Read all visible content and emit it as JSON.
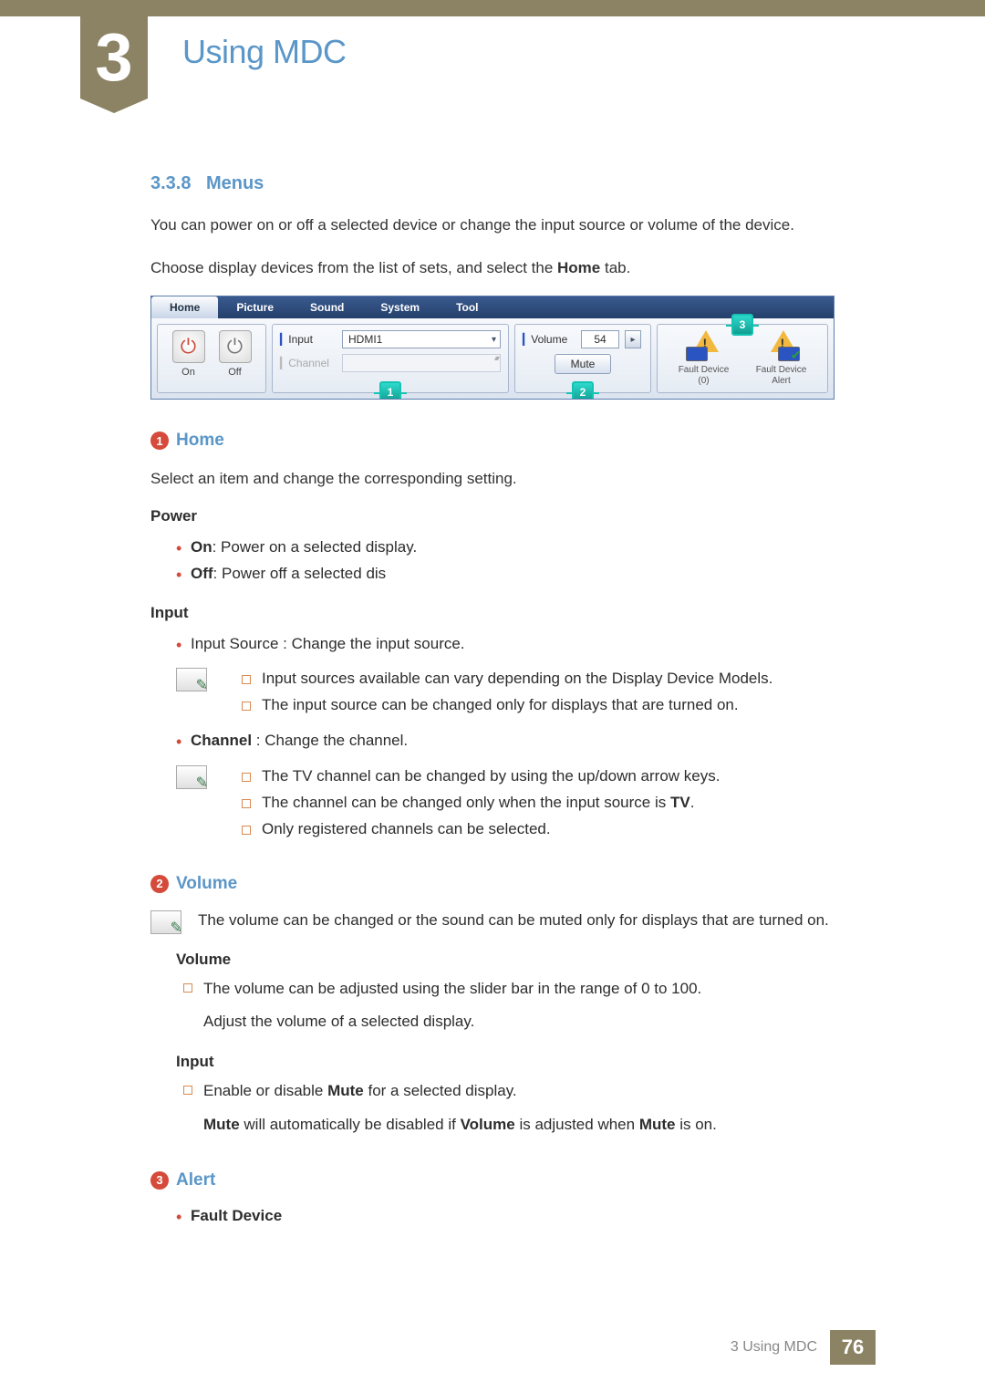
{
  "chapter": {
    "number": "3",
    "title": "Using MDC"
  },
  "section": {
    "number": "3.3.8",
    "title": "Menus"
  },
  "intro1": "You can power on or off a selected device or change the input source or volume of the device.",
  "intro2_a": "Choose display devices from the list of sets, and select the ",
  "intro2_bold": "Home",
  "intro2_b": " tab.",
  "ui": {
    "tabs": [
      "Home",
      "Picture",
      "Sound",
      "System",
      "Tool"
    ],
    "power": {
      "on": "On",
      "off": "Off"
    },
    "input": {
      "label": "Input",
      "value": "HDMI1",
      "channel_label": "Channel"
    },
    "volume": {
      "label": "Volume",
      "value": "54",
      "mute": "Mute"
    },
    "alert": {
      "fault0": "Fault Device\n(0)",
      "faultAlert": "Fault Device\nAlert"
    },
    "callouts": {
      "c1": "1",
      "c2": "2",
      "c3": "3"
    }
  },
  "h_home": "Home",
  "home_intro": "Select an item and change the corresponding setting.",
  "power": {
    "heading": "Power",
    "on_bold": "On",
    "on_text": ": Power on a selected display.",
    "off_bold": "Off",
    "off_text": ": Power off a selected dis"
  },
  "input": {
    "heading": "Input",
    "source_line": "Input Source : Change the input source.",
    "note1a": "Input sources available can vary depending on the Display Device Models.",
    "note1b": "The input source can be changed only for displays that are turned on.",
    "channel_bold": "Channel",
    "channel_text": " : Change the channel.",
    "note2a": "The TV channel can be changed by using the up/down arrow keys.",
    "note2b_a": "The channel can be changed only when the input source is ",
    "note2b_bold": "TV",
    "note2b_b": ".",
    "note2c": "Only registered channels can be selected."
  },
  "h_volume": "Volume",
  "volume": {
    "intro": "The volume can be changed or the sound can be muted only for displays that are turned on.",
    "vol_heading": "Volume",
    "vol_line1": "The volume can be adjusted using the slider bar in the range of 0 to 100.",
    "vol_line2": "Adjust the volume of a selected display.",
    "in_heading": "Input",
    "in_line1_a": "Enable or disable ",
    "in_line1_bold": "Mute",
    "in_line1_b": " for a selected display.",
    "in_line2_a": "Mute",
    "in_line2_b": " will automatically be disabled if ",
    "in_line2_c": "Volume",
    "in_line2_d": " is adjusted when ",
    "in_line2_e": "Mute",
    "in_line2_f": " is on."
  },
  "h_alert": "Alert",
  "alert": {
    "fault_bold": "Fault Device"
  },
  "footer": {
    "text": "3 Using MDC",
    "page": "76"
  }
}
